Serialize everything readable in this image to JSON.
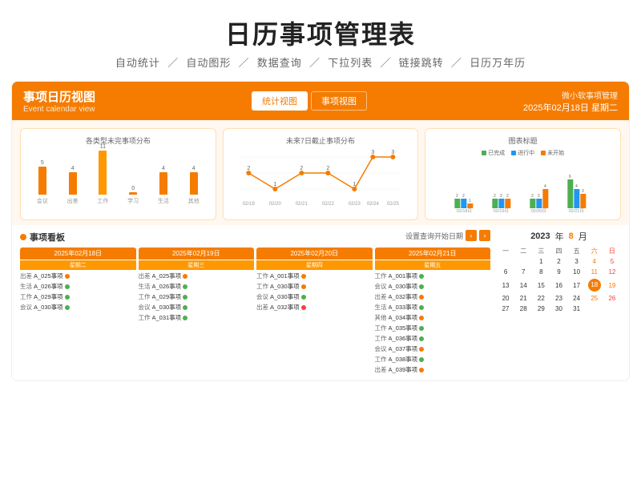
{
  "header": {
    "title": "日历事项管理表",
    "subtitle_items": [
      "自动统计",
      "自动图形",
      "数据查询",
      "下拉列表",
      "链接跳转",
      "日历万年历"
    ]
  },
  "topbar": {
    "title_cn": "事项日历视图",
    "title_en": "Event calendar view",
    "tab_stats": "统计视图",
    "tab_events": "事项视图",
    "user": "微小软事项管理",
    "date": "2025年02月18日 星期二"
  },
  "chart1": {
    "title": "各类型未完事项分布",
    "bars": [
      {
        "label": "会议",
        "value": 5
      },
      {
        "label": "出差",
        "value": 4
      },
      {
        "label": "工作",
        "value": 11
      },
      {
        "label": "学习",
        "value": 0
      },
      {
        "label": "生活",
        "value": 4
      },
      {
        "label": "其他",
        "value": 4
      }
    ]
  },
  "chart2": {
    "title": "未来7日截止事项分布",
    "points": [
      {
        "label": "02/19",
        "value": 2
      },
      {
        "label": "02/20",
        "value": 1
      },
      {
        "label": "02/21",
        "value": 2
      },
      {
        "label": "02/22",
        "value": 2
      },
      {
        "label": "02/23",
        "value": 1
      },
      {
        "label": "02/24",
        "value": 3
      },
      {
        "label": "02/25",
        "value": 3
      }
    ]
  },
  "chart3": {
    "title": "图表标题",
    "legend": [
      "已完成",
      "进行中",
      "未开始"
    ],
    "groups": [
      {
        "label": "02/18日",
        "v1": 2,
        "v2": 2,
        "v3": 1
      },
      {
        "label": "02/19日",
        "v1": 2,
        "v2": 2,
        "v3": 2
      },
      {
        "label": "02/20日",
        "v1": 2,
        "v2": 2,
        "v3": 4
      },
      {
        "label": "02/21日",
        "v1": 6,
        "v2": 4,
        "v3": 3
      }
    ]
  },
  "board": {
    "title": "事项看板",
    "settings_label": "设置查询开始日期",
    "days": [
      {
        "date": "2025年02月18日",
        "weekday": "星期二",
        "events": [
          {
            "type": "出差",
            "name": "A_025事项",
            "status": "orange"
          },
          {
            "type": "生活",
            "name": "A_026事项",
            "status": "green"
          },
          {
            "type": "工作",
            "name": "A_029事项",
            "status": "green"
          },
          {
            "type": "会议",
            "name": "A_030事项",
            "status": "green"
          }
        ]
      },
      {
        "date": "2025年02月19日",
        "weekday": "星期三",
        "events": [
          {
            "type": "出差",
            "name": "A_025事项",
            "status": "orange"
          },
          {
            "type": "生活",
            "name": "A_026事项",
            "status": "green"
          },
          {
            "type": "工作",
            "name": "A_029事项",
            "status": "green"
          },
          {
            "type": "会议",
            "name": "A_030事项",
            "status": "green"
          },
          {
            "type": "工作",
            "name": "A_031事项",
            "status": "green"
          }
        ]
      },
      {
        "date": "2025年02月20日",
        "weekday": "星期四",
        "events": [
          {
            "type": "工作",
            "name": "A_001事项",
            "status": "orange"
          },
          {
            "type": "工作",
            "name": "A_030事项",
            "status": "orange"
          },
          {
            "type": "会议",
            "name": "A_030事项",
            "status": "green"
          },
          {
            "type": "出差",
            "name": "A_032事项",
            "status": "red"
          }
        ]
      },
      {
        "date": "2025年02月21日",
        "weekday": "星期五",
        "events": [
          {
            "type": "工作",
            "name": "A_001事项",
            "status": "green"
          },
          {
            "type": "会议",
            "name": "A_030事项",
            "status": "green"
          },
          {
            "type": "出差",
            "name": "A_032事项",
            "status": "orange"
          },
          {
            "type": "生活",
            "name": "A_033事项",
            "status": "green"
          },
          {
            "type": "其他",
            "name": "A_034事项",
            "status": "orange"
          },
          {
            "type": "工作",
            "name": "A_035事项",
            "status": "green"
          },
          {
            "type": "工作",
            "name": "A_036事项",
            "status": "green"
          },
          {
            "type": "会议",
            "name": "A_037事项",
            "status": "orange"
          },
          {
            "type": "工作",
            "name": "A_038事项",
            "status": "green"
          },
          {
            "type": "出差",
            "name": "A_039事项",
            "status": "orange"
          }
        ]
      }
    ]
  },
  "mini_calendar": {
    "year": "2023",
    "month": "8",
    "year_label": "年",
    "month_label": "月",
    "weekdays": [
      "一",
      "二",
      "三",
      "四",
      "五",
      "六",
      "日"
    ],
    "rows": [
      [
        "",
        "",
        "1",
        "2",
        "3",
        "4",
        "5"
      ],
      [
        "6",
        "7",
        "8",
        "9",
        "10",
        "11",
        "12"
      ],
      [
        "13",
        "14",
        "15",
        "16",
        "17",
        "18",
        "19"
      ],
      [
        "20",
        "21",
        "22",
        "23",
        "24",
        "25",
        "26"
      ],
      [
        "27",
        "28",
        "29",
        "30",
        "31",
        "",
        ""
      ]
    ],
    "today": "18",
    "highlight_sat": [
      "5",
      "12",
      "19",
      "26"
    ],
    "highlight_sun": [
      "6",
      "13",
      "20",
      "27"
    ],
    "red_dates": [
      "12",
      "13"
    ]
  }
}
